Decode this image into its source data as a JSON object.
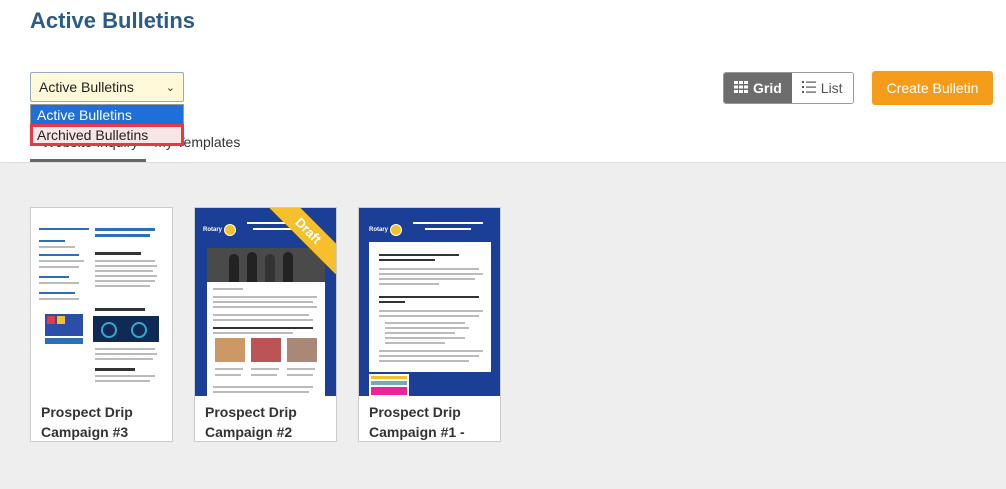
{
  "header": {
    "title": "Active Bulletins"
  },
  "filter": {
    "selected": "Active Bulletins",
    "options": [
      "Active Bulletins",
      "Archived Bulletins"
    ]
  },
  "tabs": [
    {
      "label": "Website Inquiry"
    },
    {
      "label": "My Templates"
    }
  ],
  "toolbar": {
    "grid_label": "Grid",
    "list_label": "List",
    "create_label": "Create Bulletin"
  },
  "cards": [
    {
      "title": "Prospect Drip Campaign #3"
    },
    {
      "title": "Prospect Drip Campaign #2",
      "badge": "Draft"
    },
    {
      "title": "Prospect Drip Campaign #1 -"
    }
  ],
  "colors": {
    "title": "#2d5b87",
    "create_button": "#f59d1b",
    "selected_option": "#1e6fd9",
    "highlight_border": "#e53945",
    "newsletter_blue": "#1b3f96"
  },
  "icons": {
    "grid": "grid-icon",
    "list": "list-icon",
    "dropdown": "chevron-down-icon"
  }
}
